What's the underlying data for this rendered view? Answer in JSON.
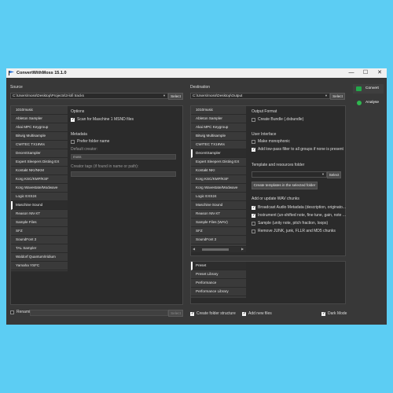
{
  "app": {
    "title": "ConvertWithMoss 15.1.0"
  },
  "window_controls": {
    "minimize": "—",
    "maximize": "☐",
    "close": "✕"
  },
  "source": {
    "label": "Source",
    "path": "C:\\Users\\moss\\Desktop\\Projects\\3-lofi tracks",
    "select_label": "Select",
    "formats": [
      "1010music",
      "Ableton Sampler",
      "Akai MPC Keygroup",
      "Bitwig Multisample",
      "CWITEC TX16Wx",
      "DecentSampler",
      "Expert Sleepers Disting EX",
      "Kontakt NKI/NKM",
      "Korg KSC/KMP/KSF",
      "Korg Wavestate/Modwave",
      "Logic EXS24",
      "Maschine Sound",
      "Reason NN-XT",
      "Sample Files",
      "SFZ",
      "SoundFont 2",
      "TAL Sampler",
      "Waldorf Quantum/Iridium",
      "Yamaha YSFC"
    ],
    "selected_index": 11,
    "options": {
      "header": "Options",
      "scan_label": "Scan for Maschine 1 MSND files",
      "scan_checked": true
    },
    "metadata": {
      "header": "Metadata",
      "prefer_folder_label": "Prefer folder name",
      "prefer_folder_checked": false,
      "default_creator_label": "Default creator:",
      "default_creator_value": "moss",
      "creator_tags_label": "Creator tags (if found in name or path):",
      "creator_tags_value": ""
    },
    "renaming_label": "Renaming",
    "renaming_checked": false,
    "renaming_select_label": "Select"
  },
  "destination": {
    "label": "Destination",
    "path": "C:\\Users\\moss\\Desktop\\Output",
    "select_label": "Select",
    "formats": [
      "1010music",
      "Ableton Sampler",
      "Akai MPC Keygroup",
      "Bitwig Multisample",
      "CWITEC TX16Wx",
      "DecentSampler",
      "Expert Sleepers Disting EX",
      "Kontakt NKI",
      "Korg KSC/KMP/KSF",
      "Korg Wavestate/Modwave",
      "Logic EXS24",
      "Maschine Sound",
      "Reason NN-XT",
      "Sample Files (WAV)",
      "SFZ",
      "SoundFont 2"
    ],
    "selected_index": 5,
    "output_format": {
      "header": "Output Format",
      "create_bundle_label": "Create Bundle (.dsbundle)",
      "create_bundle_checked": false
    },
    "user_interface": {
      "header": "User Interface",
      "monophonic_label": "Make monophonic",
      "monophonic_checked": false,
      "lowpass_label": "Add low-pass filter to all groups if none is present",
      "lowpass_checked": true
    },
    "templates": {
      "header": "Template and resources folder",
      "select_label": "Select",
      "create_button": "Create templates in the selected folder"
    },
    "wav_chunks": {
      "header": "Add or update WAV chunks",
      "items": [
        {
          "label": "Broadcast Audio Metadata (description, originato...",
          "checked": true
        },
        {
          "label": "Instrument (un-shifted note, fine tune, gain, note ...",
          "checked": true
        },
        {
          "label": "Sample (unity note, pitch fraction, loops)",
          "checked": false
        },
        {
          "label": "Remove JUNK, junk, FLLR and MD5 chunks",
          "checked": false
        }
      ]
    },
    "presets": [
      "Preset",
      "Preset Library",
      "Performance",
      "Performance Library"
    ],
    "preset_selected_index": 0,
    "create_folder_label": "Create folder structure",
    "create_folder_checked": true,
    "add_new_files_label": "Add new files",
    "add_new_files_checked": true,
    "dark_mode_label": "Dark Mode",
    "dark_mode_checked": true
  },
  "actions": {
    "convert_label": "Convert",
    "analyse_label": "Analyse"
  },
  "colors": {
    "accent": "#23a84a",
    "background": "#5ccdf3",
    "window": "#383838"
  }
}
